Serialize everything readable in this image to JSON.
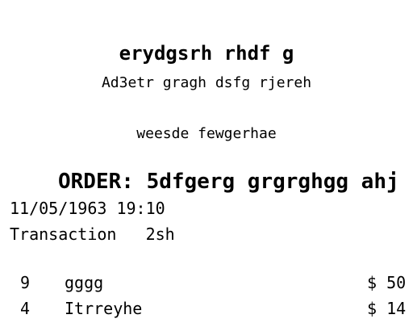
{
  "header": {
    "store_name": "erydgsrh rhdf g",
    "address": "Ad3etr gragh dsfg rjereh",
    "tagline": "weesde fewgerhae"
  },
  "order": {
    "label": "ORDER: 5dfgerg grgrghgg ahj",
    "datetime": "11/05/1963 19:10",
    "transaction": "Transaction   2sh"
  },
  "items": [
    {
      "qty": "9",
      "name": "gggg",
      "price": "$ 50"
    },
    {
      "qty": "4",
      "name": "Itrreyhe",
      "price": "$ 14"
    }
  ]
}
